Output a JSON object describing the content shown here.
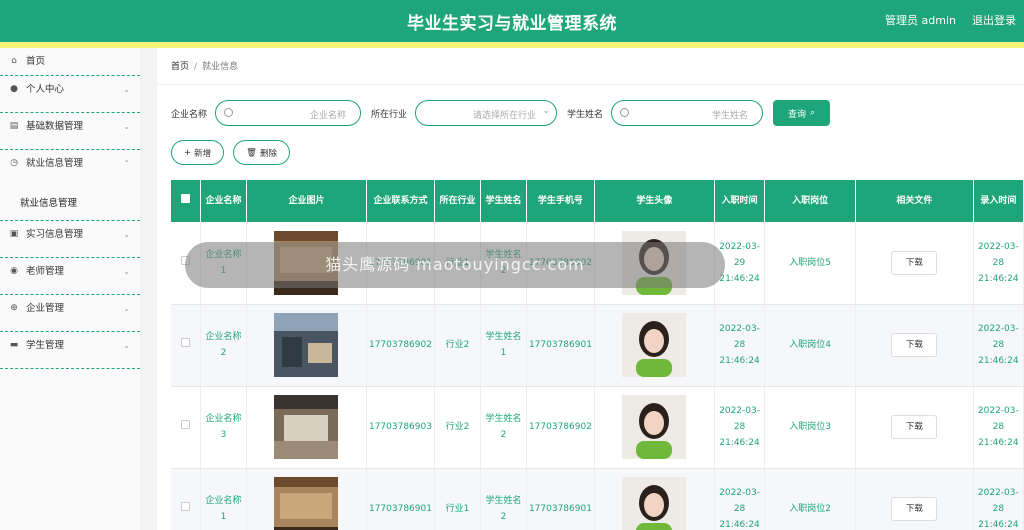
{
  "header": {
    "title": "毕业生实习与就业管理系统",
    "user": "管理员 admin",
    "logout": "退出登录"
  },
  "sidebar": {
    "items": [
      {
        "label": "首页",
        "icon": "home-icon"
      },
      {
        "label": "个人中心",
        "icon": "user-icon"
      },
      {
        "label": "基础数据管理",
        "icon": "chart-icon"
      },
      {
        "label": "就业信息管理",
        "icon": "clock-icon"
      },
      {
        "label": "实习信息管理",
        "icon": "clipboard-icon"
      },
      {
        "label": "老师管理",
        "icon": "location-icon"
      },
      {
        "label": "企业管理",
        "icon": "target-icon"
      },
      {
        "label": "学生管理",
        "icon": "printer-icon"
      }
    ],
    "sub_item": "就业信息管理"
  },
  "breadcrumb": {
    "home": "首页",
    "current": "就业信息"
  },
  "search": {
    "company_label": "企业名称",
    "company_placeholder": "企业名称",
    "industry_label": "所在行业",
    "industry_placeholder": "请选择所在行业",
    "student_label": "学生姓名",
    "student_placeholder": "学生姓名",
    "query_button": "查询"
  },
  "actions": {
    "add": "新增",
    "delete": "删除"
  },
  "table": {
    "columns": [
      "企业名称",
      "企业图片",
      "企业联系方式",
      "所在行业",
      "学生姓名",
      "学生手机号",
      "学生头像",
      "入职时间",
      "入职岗位",
      "相关文件",
      "录入时间"
    ],
    "download_label": "下载",
    "rows": [
      {
        "company": "企业名称1",
        "phone": "17703786901",
        "industry": "行业1",
        "student": "学生姓名2",
        "student_phone": "17703786902",
        "join_time": "2022-03-29 21:46:24",
        "position": "入职岗位5",
        "entry_time": "2022-03-28 21:46:24"
      },
      {
        "company": "企业名称2",
        "phone": "17703786902",
        "industry": "行业2",
        "student": "学生姓名1",
        "student_phone": "17703786901",
        "join_time": "2022-03-28 21:46:24",
        "position": "入职岗位4",
        "entry_time": "2022-03-28 21:46:24"
      },
      {
        "company": "企业名称3",
        "phone": "17703786903",
        "industry": "行业2",
        "student": "学生姓名2",
        "student_phone": "17703786902",
        "join_time": "2022-03-28 21:46:24",
        "position": "入职岗位3",
        "entry_time": "2022-03-28 21:46:24"
      },
      {
        "company": "企业名称1",
        "phone": "17703786901",
        "industry": "行业1",
        "student": "学生姓名2",
        "student_phone": "17703786901",
        "join_time": "2022-03-28 21:46:24",
        "position": "入职岗位2",
        "entry_time": "2022-03-28 21:46:24"
      }
    ]
  },
  "toast": "猫头鹰源码 maotouyingcc.com",
  "colors": {
    "accent": "#1fa57a",
    "stripe": "#f4f47a"
  }
}
